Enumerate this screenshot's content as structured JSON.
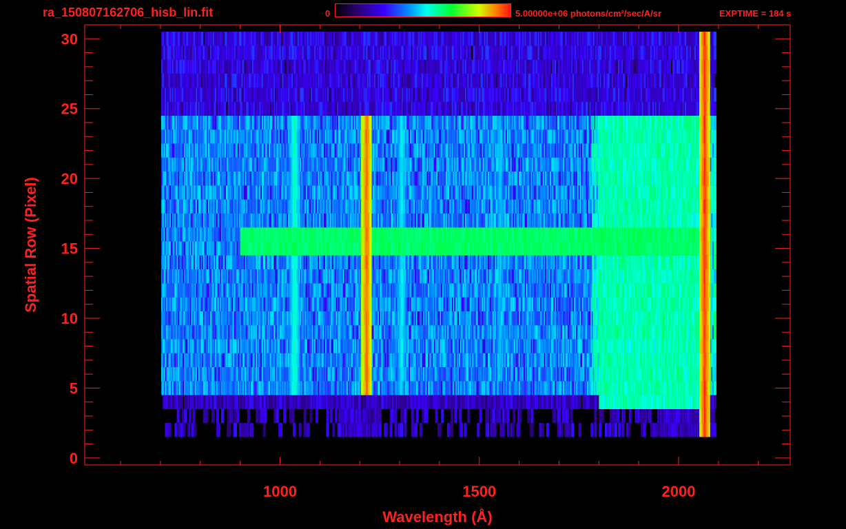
{
  "header": {
    "filename": "ra_150807162706_hisb_lin.fit",
    "colorbar_min": "0",
    "colorbar_max": "5.00000e+06 photons/cm²/sec/A/sr",
    "exptime": "EXPTIME = 184 s"
  },
  "colors": {
    "axis": "#ff2020",
    "background": "#000000"
  },
  "chart_data": {
    "type": "heatmap",
    "title": "",
    "xlabel": "Wavelength (Å)",
    "ylabel": "Spatial Row (Pixel)",
    "xlim": [
      510,
      2280
    ],
    "ylim": [
      -0.5,
      31
    ],
    "xticks": [
      1000,
      1500,
      2000
    ],
    "xtick_labels": [
      "1000",
      "1500",
      "2000"
    ],
    "yticks": [
      0,
      5,
      10,
      15,
      20,
      25,
      30
    ],
    "ytick_labels": [
      "0",
      "5",
      "10",
      "15",
      "20",
      "25",
      "30"
    ],
    "grid": false,
    "colormap": "rainbow",
    "value_range": [
      0,
      5000000
    ],
    "features": [
      {
        "name": "",
        "x": 1216,
        "row_range": [
          5,
          24
        ],
        "level": 0.92
      },
      {
        "name": "",
        "x": 1035,
        "row_range": [
          5,
          24
        ],
        "level": 0.55
      },
      {
        "name": "",
        "x": 1304,
        "row_range": [
          6,
          24
        ],
        "level": 0.5
      },
      {
        "name": "",
        "x": 1550,
        "row_range": [
          6,
          24
        ],
        "level": 0.45
      },
      {
        "name": "",
        "x_range": [
          900,
          2060
        ],
        "row": 15.5,
        "level": 0.65
      },
      {
        "name": "",
        "x_range": [
          1800,
          2060
        ],
        "row_range": [
          4,
          24
        ],
        "level": 0.62
      },
      {
        "name": "",
        "x": 2064,
        "row_range": [
          2,
          30
        ],
        "level": 0.95
      }
    ]
  }
}
